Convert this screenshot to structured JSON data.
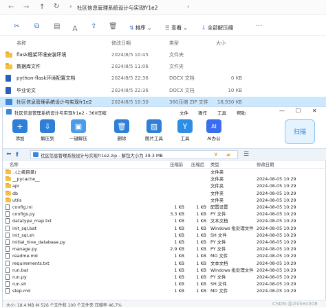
{
  "explorer": {
    "nav": {
      "path": "社区信息管理系统设计与实现fr1e2"
    },
    "toolbar": {
      "sort": "排序",
      "view": "查看",
      "extract_all": "全部解压缩"
    },
    "columns": {
      "name": "名称",
      "date": "修改日期",
      "type": "类型",
      "size": "大小"
    },
    "files": [
      {
        "name": "flask框架环境安装环境",
        "date": "2024/8/5 10:45",
        "type": "文件夹",
        "size": "",
        "icon": "folder-icon"
      },
      {
        "name": "数据库文件",
        "date": "2024/8/5 11:06",
        "type": "文件夹",
        "size": "",
        "icon": "folder-icon"
      },
      {
        "name": "python-flask环境配置文档",
        "date": "2024/8/5 22:36",
        "type": "DOCX 文档",
        "size": "0 KB",
        "icon": "docx-icon"
      },
      {
        "name": "毕业论文",
        "date": "2024/8/5 22:36",
        "type": "DOCX 文档",
        "size": "10 KB",
        "icon": "docx-icon"
      },
      {
        "name": "社区信息管理系统设计与实现fr1e2",
        "date": "2024/8/5 10:30",
        "type": "360压缩 ZIP 文件",
        "size": "18,930 KB",
        "icon": "zip-icon"
      }
    ]
  },
  "zip": {
    "title": "社区信息管理系统设计与实现fr1e2 - 360压缩",
    "menu": [
      "文件",
      "操作",
      "工具",
      "帮助"
    ],
    "toolbar": [
      "添加",
      "解压到",
      "一键解压",
      "删除",
      "图片工具",
      "工具",
      "AI办公"
    ],
    "scan_label": "扫描",
    "path": "社区信息管理系统设计与实现fr1e2.zip - 解包大小为 39.3 MB",
    "columns": {
      "name": "名称",
      "size": "压缩前",
      "packed": "压缩后",
      "type": "类型",
      "date": "修改日期"
    },
    "rows": [
      {
        "name": "..(上级目录)",
        "size": "",
        "packed": "",
        "type": "文件夹",
        "date": ""
      },
      {
        "name": "__pycache__",
        "size": "",
        "packed": "",
        "type": "文件夹",
        "date": "2024-08-05 10:29"
      },
      {
        "name": "api",
        "size": "",
        "packed": "",
        "type": "文件夹",
        "date": "2024-08-05 10:29"
      },
      {
        "name": "db",
        "size": "",
        "packed": "",
        "type": "文件夹",
        "date": "2024-08-05 10:29"
      },
      {
        "name": "utils",
        "size": "",
        "packed": "",
        "type": "文件夹",
        "date": "2024-08-05 10:29"
      },
      {
        "name": "config.ini",
        "size": "1 KB",
        "packed": "1 KB",
        "type": "配置设置",
        "date": "2024-08-05 10:29"
      },
      {
        "name": "configs.py",
        "size": "3.3 KB",
        "packed": "1 KB",
        "type": "PY 文件",
        "date": "2024-08-05 10:29"
      },
      {
        "name": "datatype_map.txt",
        "size": "1 KB",
        "packed": "1 KB",
        "type": "文本文档",
        "date": "2024-08-05 10:29"
      },
      {
        "name": "init_sql.bat",
        "size": "1 KB",
        "packed": "1 KB",
        "type": "Windows 批处理文件",
        "date": "2024-08-05 10:29"
      },
      {
        "name": "init_sql.sh",
        "size": "1 KB",
        "packed": "1 KB",
        "type": "SH 文件",
        "date": "2024-08-05 10:29"
      },
      {
        "name": "initial_hive_database.py",
        "size": "1 KB",
        "packed": "1 KB",
        "type": "PY 文件",
        "date": "2024-08-05 10:29"
      },
      {
        "name": "manage.py",
        "size": "2.9 KB",
        "packed": "1 KB",
        "type": "PY 文件",
        "date": "2024-08-05 10:29"
      },
      {
        "name": "readme.md",
        "size": "1 KB",
        "packed": "1 KB",
        "type": "MD 文件",
        "date": "2024-08-05 10:29"
      },
      {
        "name": "requirements.txt",
        "size": "1 KB",
        "packed": "1 KB",
        "type": "文本文档",
        "date": "2024-08-05 10:29"
      },
      {
        "name": "run.bat",
        "size": "1 KB",
        "packed": "1 KB",
        "type": "Windows 批处理文件",
        "date": "2024-08-05 10:29"
      },
      {
        "name": "run.py",
        "size": "1 KB",
        "packed": "1 KB",
        "type": "PY 文件",
        "date": "2024-08-05 10:29"
      },
      {
        "name": "run.sh",
        "size": "1 KB",
        "packed": "1 KB",
        "type": "SH 文件",
        "date": "2024-08-05 10:29"
      },
      {
        "name": "step.md",
        "size": "1 KB",
        "packed": "1 KB",
        "type": "MD 文件",
        "date": "2024-08-05 10:29"
      }
    ],
    "status": "大小: 18.4 MB 共 526 个文件和 100 个文件夹 压缩率 46.7%",
    "watermark": "CSDN @zhiheo508"
  }
}
